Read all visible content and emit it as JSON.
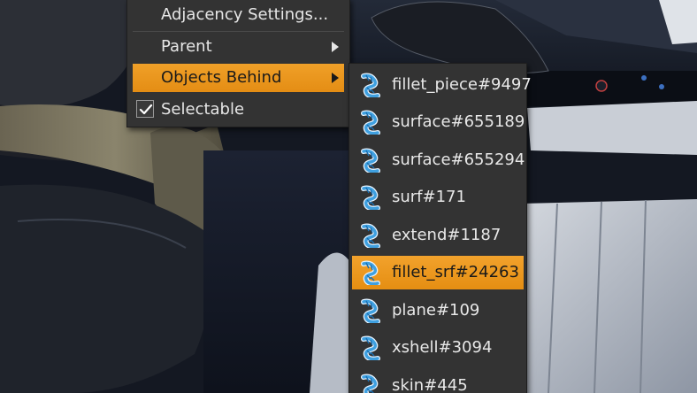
{
  "context_menu": {
    "items": [
      {
        "label": "Adjacency Settings...",
        "has_submenu": false
      },
      {
        "label": "Parent",
        "has_submenu": true
      },
      {
        "label": "Objects Behind",
        "has_submenu": true,
        "active": true
      },
      {
        "label": "Selectable",
        "checked": true
      }
    ]
  },
  "submenu": {
    "items": [
      {
        "label": "fillet_piece#9497",
        "icon": "surface-icon"
      },
      {
        "label": "surface#655189",
        "icon": "surface-icon"
      },
      {
        "label": "surface#655294",
        "icon": "surface-icon"
      },
      {
        "label": "surf#171",
        "icon": "surface-icon"
      },
      {
        "label": "extend#1187",
        "icon": "surface-icon"
      },
      {
        "label": "fillet_srf#24263",
        "icon": "surface-icon",
        "active": true
      },
      {
        "label": "plane#109",
        "icon": "surface-icon"
      },
      {
        "label": "xshell#3094",
        "icon": "surface-icon"
      },
      {
        "label": "skin#445",
        "icon": "surface-icon"
      }
    ]
  },
  "colors": {
    "menu_bg": "#333333",
    "highlight": "#ee9a22",
    "icon_blue": "#3fa0e0"
  }
}
